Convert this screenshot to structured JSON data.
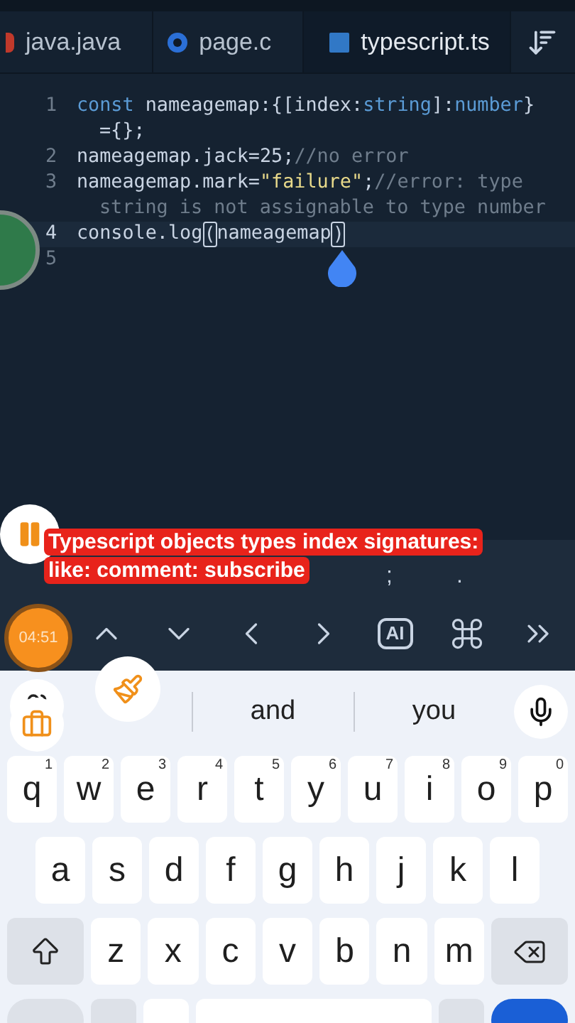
{
  "tabs": [
    {
      "label": "java.java",
      "selected": false
    },
    {
      "label": "page.c",
      "selected": false
    },
    {
      "label": "typescript.ts",
      "selected": true
    }
  ],
  "code_lines": [
    {
      "number": "1",
      "current": false,
      "rows": [
        [
          {
            "text": "const ",
            "kind": "keyword"
          },
          {
            "text": "nameagemap:{[index:",
            "kind": "plain"
          },
          {
            "text": "string",
            "kind": "keyword"
          },
          {
            "text": "]:",
            "kind": "plain"
          },
          {
            "text": "number",
            "kind": "keyword"
          },
          {
            "text": "}",
            "kind": "plain"
          }
        ],
        [
          {
            "text": "={};",
            "kind": "plain"
          }
        ]
      ]
    },
    {
      "number": "2",
      "current": false,
      "rows": [
        [
          {
            "text": "nameagemap.jack=25;",
            "kind": "plain"
          },
          {
            "text": "//no error",
            "kind": "comment"
          }
        ]
      ]
    },
    {
      "number": "3",
      "current": false,
      "rows": [
        [
          {
            "text": "nameagemap.mark=",
            "kind": "plain"
          },
          {
            "text": "\"failure\"",
            "kind": "string"
          },
          {
            "text": ";",
            "kind": "plain"
          },
          {
            "text": "//error: type",
            "kind": "comment"
          }
        ],
        [
          {
            "text": "string is not assignable to type number",
            "kind": "comment"
          }
        ]
      ]
    },
    {
      "number": "4",
      "current": true,
      "rows": [
        [
          {
            "text": "console.log",
            "kind": "plain"
          },
          {
            "text": "(",
            "kind": "bracket"
          },
          {
            "text": "nameagemap",
            "kind": "plain"
          },
          {
            "text": ")",
            "kind": "bracket"
          }
        ]
      ]
    },
    {
      "number": "5",
      "current": false,
      "rows": [
        []
      ]
    }
  ],
  "symbols": [
    ";",
    "."
  ],
  "caption": "Typescript objects types index signatures: like: comment: subscribe",
  "timer": "04:51",
  "ai_label": "AI",
  "suggestions": [
    "and",
    "you"
  ],
  "keyboard": {
    "rows": [
      [
        {
          "key": "q",
          "hint": "1"
        },
        {
          "key": "w",
          "hint": "2"
        },
        {
          "key": "e",
          "hint": "3"
        },
        {
          "key": "r",
          "hint": "4"
        },
        {
          "key": "t",
          "hint": "5"
        },
        {
          "key": "y",
          "hint": "6"
        },
        {
          "key": "u",
          "hint": "7"
        },
        {
          "key": "i",
          "hint": "8"
        },
        {
          "key": "o",
          "hint": "9"
        },
        {
          "key": "p",
          "hint": "0"
        }
      ],
      [
        {
          "key": "a"
        },
        {
          "key": "s"
        },
        {
          "key": "d"
        },
        {
          "key": "f"
        },
        {
          "key": "g"
        },
        {
          "key": "h"
        },
        {
          "key": "j"
        },
        {
          "key": "k"
        },
        {
          "key": "l"
        }
      ],
      [
        {
          "key": "z"
        },
        {
          "key": "x"
        },
        {
          "key": "c"
        },
        {
          "key": "v"
        },
        {
          "key": "b"
        },
        {
          "key": "n"
        },
        {
          "key": "m"
        }
      ]
    ]
  }
}
